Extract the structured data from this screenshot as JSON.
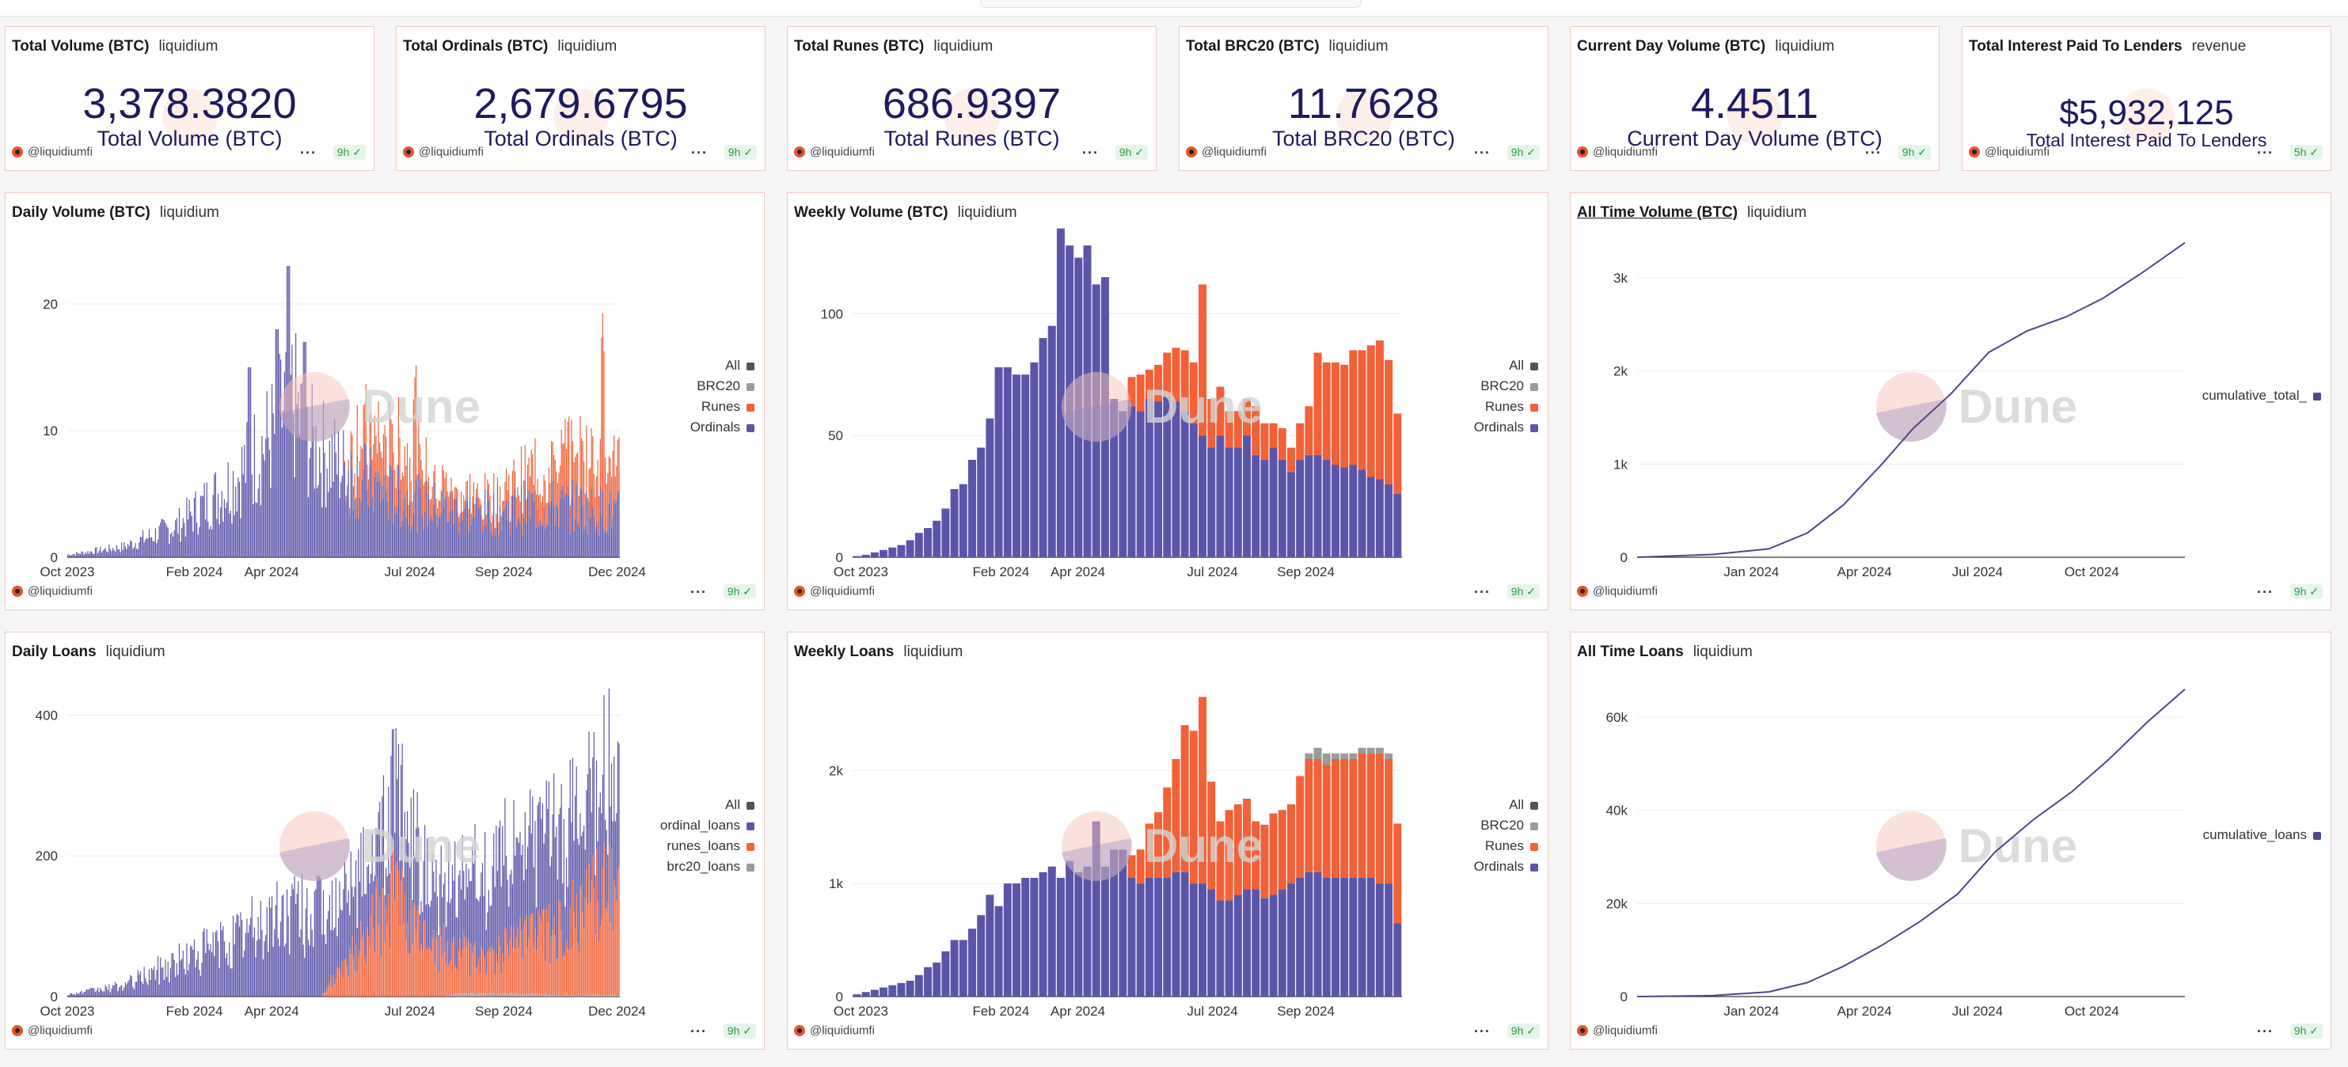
{
  "footer_handle": "@liquidiumfi",
  "more_label": "···",
  "watermark_text": "Dune",
  "colors": {
    "ordinals": "#5a55a8",
    "runes": "#f26137",
    "brc20": "#9b9b9b",
    "all": "#555555",
    "line": "#4b4a8a"
  },
  "counters": [
    {
      "title": "Total Volume (BTC)",
      "owner": "liquidium",
      "value": "3,378.3820",
      "label": "Total Volume (BTC)",
      "age": "9h"
    },
    {
      "title": "Total Ordinals (BTC)",
      "owner": "liquidium",
      "value": "2,679.6795",
      "label": "Total Ordinals (BTC)",
      "age": "9h"
    },
    {
      "title": "Total Runes (BTC)",
      "owner": "liquidium",
      "value": "686.9397",
      "label": "Total Runes (BTC)",
      "age": "9h"
    },
    {
      "title": "Total BRC20 (BTC)",
      "owner": "liquidium",
      "value": "11.7628",
      "label": "Total BRC20 (BTC)",
      "age": "9h"
    },
    {
      "title": "Current Day Volume (BTC)",
      "owner": "liquidium",
      "value": "4.4511",
      "label": "Current Day Volume (BTC)",
      "age": "9h"
    },
    {
      "title": "Total Interest Paid To Lenders",
      "owner": "revenue",
      "value": "$5,932,125",
      "label": "Total Interest Paid To Lenders",
      "age": "5h"
    }
  ],
  "charts": [
    {
      "title": "Daily Volume (BTC)",
      "owner": "liquidium",
      "age": "9h",
      "legend": [
        "All",
        "BRC20",
        "Runes",
        "Ordinals"
      ]
    },
    {
      "title": "Weekly Volume (BTC)",
      "owner": "liquidium",
      "age": "9h",
      "legend": [
        "All",
        "BRC20",
        "Runes",
        "Ordinals"
      ]
    },
    {
      "title": "All Time Volume (BTC)",
      "owner": "liquidium",
      "age": "9h",
      "legend": [
        "cumulative_total_"
      ]
    },
    {
      "title": "Daily Loans",
      "owner": "liquidium",
      "age": "9h",
      "legend": [
        "All",
        "ordinal_loans",
        "runes_loans",
        "brc20_loans"
      ]
    },
    {
      "title": "Weekly Loans",
      "owner": "liquidium",
      "age": "9h",
      "legend": [
        "All",
        "BRC20",
        "Runes",
        "Ordinals"
      ]
    },
    {
      "title": "All Time Loans",
      "owner": "liquidium",
      "age": "9h",
      "legend": [
        "cumulative_loans"
      ]
    }
  ],
  "chart_data": [
    {
      "type": "bar",
      "title": "Daily Volume (BTC)",
      "stacked": true,
      "x_start": "2023-10-01",
      "x_end": "2024-12-15",
      "xticks": [
        "Oct 2023",
        "Feb 2024",
        "Apr 2024",
        "Jul 2024",
        "Sep 2024",
        "Dec 2024"
      ],
      "ylim": [
        0,
        25
      ],
      "yticks": [
        0,
        10,
        20
      ],
      "legend_position": "right",
      "series": [
        {
          "name": "Ordinals",
          "profile": [
            [
              0,
              0.2
            ],
            [
              0.1,
              0.8
            ],
            [
              0.2,
              2.5
            ],
            [
              0.3,
              6
            ],
            [
              0.38,
              10
            ],
            [
              0.4,
              13
            ],
            [
              0.44,
              9
            ],
            [
              0.5,
              7
            ],
            [
              0.58,
              5
            ],
            [
              0.66,
              4
            ],
            [
              0.75,
              3.5
            ],
            [
              0.85,
              4
            ],
            [
              0.93,
              4
            ],
            [
              1,
              3.5
            ]
          ],
          "peaks": [
            [
              0.33,
              15
            ],
            [
              0.38,
              18
            ],
            [
              0.4,
              23
            ],
            [
              0.43,
              17
            ]
          ]
        },
        {
          "name": "Runes",
          "profile": [
            [
              0,
              0
            ],
            [
              0.5,
              0
            ],
            [
              0.53,
              3.5
            ],
            [
              0.6,
              4
            ],
            [
              0.65,
              3
            ],
            [
              0.7,
              1.5
            ],
            [
              0.75,
              1
            ],
            [
              0.82,
              2
            ],
            [
              0.9,
              4
            ],
            [
              0.97,
              4.5
            ],
            [
              1,
              3.5
            ]
          ],
          "peaks": [
            [
              0.63,
              9
            ],
            [
              0.97,
              14
            ]
          ]
        },
        {
          "name": "BRC20",
          "profile": [
            [
              0,
              0
            ],
            [
              1,
              0
            ]
          ]
        },
        {
          "name": "All",
          "profile": [
            [
              0,
              0
            ],
            [
              1,
              0
            ]
          ]
        }
      ]
    },
    {
      "type": "bar",
      "title": "Weekly Volume (BTC)",
      "stacked": true,
      "xticks": [
        "Oct 2023",
        "Feb 2024",
        "Apr 2024",
        "Jul 2024",
        "Sep 2024"
      ],
      "ylim": [
        0,
        130
      ],
      "yticks": [
        0,
        50,
        100
      ],
      "legend_position": "right",
      "categories_count": 62,
      "series": [
        {
          "name": "Ordinals",
          "values": [
            0.5,
            1,
            2,
            3,
            4,
            5,
            7,
            10,
            12,
            15,
            20,
            28,
            30,
            40,
            45,
            57,
            78,
            78,
            75,
            75,
            80,
            90,
            95,
            135,
            128,
            123,
            128,
            112,
            115,
            65,
            60,
            62,
            60,
            65,
            64,
            66,
            64,
            60,
            55,
            50,
            45,
            50,
            45,
            45,
            50,
            42,
            40,
            45,
            40,
            35,
            40,
            42,
            42,
            40,
            38,
            37,
            38,
            36,
            33,
            32,
            30,
            26
          ]
        },
        {
          "name": "Runes",
          "values": [
            0,
            0,
            0,
            0,
            0,
            0,
            0,
            0,
            0,
            0,
            0,
            0,
            0,
            0,
            0,
            0,
            0,
            0,
            0,
            0,
            0,
            0,
            0,
            0,
            0,
            0,
            0,
            0,
            0,
            0,
            0,
            12,
            15,
            12,
            15,
            18,
            22,
            25,
            25,
            62,
            20,
            20,
            15,
            15,
            15,
            20,
            15,
            10,
            13,
            10,
            15,
            20,
            42,
            40,
            42,
            42,
            47,
            49,
            54,
            57,
            51,
            33
          ]
        },
        {
          "name": "BRC20",
          "values": [
            0,
            0,
            0,
            0,
            0,
            0,
            0,
            0,
            0,
            0,
            0,
            0,
            0,
            0,
            0,
            0,
            0,
            0,
            0,
            0,
            0,
            0,
            0,
            0,
            0,
            0,
            0,
            0,
            0,
            0,
            0,
            0,
            0,
            0,
            0,
            0,
            0,
            0,
            0,
            0,
            0,
            0,
            0,
            0,
            0,
            0,
            0,
            0,
            0,
            0,
            0,
            0,
            0,
            0,
            0,
            0,
            0,
            0,
            0,
            0,
            0,
            0
          ]
        }
      ]
    },
    {
      "type": "line",
      "title": "All Time Volume (BTC)",
      "xticks": [
        "Jan 2024",
        "Apr 2024",
        "Jul 2024",
        "Oct 2024"
      ],
      "xlim": [
        "2023-10-01",
        "2024-12-15"
      ],
      "ylim": [
        0,
        3400
      ],
      "yticks": [
        0,
        1000,
        2000,
        3000
      ],
      "ytick_labels": [
        "0",
        "1k",
        "2k",
        "3k"
      ],
      "legend_position": "right",
      "series": [
        {
          "name": "cumulative_total_",
          "points": [
            [
              "2023-10-01",
              0
            ],
            [
              "2023-12-01",
              30
            ],
            [
              "2024-01-15",
              90
            ],
            [
              "2024-02-15",
              260
            ],
            [
              "2024-03-15",
              560
            ],
            [
              "2024-04-15",
              1000
            ],
            [
              "2024-05-10",
              1380
            ],
            [
              "2024-06-10",
              1760
            ],
            [
              "2024-07-10",
              2200
            ],
            [
              "2024-08-10",
              2430
            ],
            [
              "2024-09-10",
              2580
            ],
            [
              "2024-10-10",
              2780
            ],
            [
              "2024-11-10",
              3050
            ],
            [
              "2024-12-15",
              3378
            ]
          ]
        }
      ]
    },
    {
      "type": "bar",
      "title": "Daily Loans",
      "stacked": true,
      "x_start": "2023-10-01",
      "x_end": "2024-12-15",
      "xticks": [
        "Oct 2023",
        "Feb 2024",
        "Apr 2024",
        "Jul 2024",
        "Sep 2024",
        "Dec 2024"
      ],
      "ylim": [
        0,
        450
      ],
      "yticks": [
        0,
        200,
        400
      ],
      "legend_position": "right",
      "series": [
        {
          "name": "brc20_loans",
          "profile": [
            [
              0,
              0
            ],
            [
              0.68,
              0
            ],
            [
              0.7,
              4
            ],
            [
              0.85,
              4
            ],
            [
              0.9,
              2
            ],
            [
              1,
              2
            ]
          ]
        },
        {
          "name": "runes_loans",
          "profile": [
            [
              0,
              0
            ],
            [
              0.46,
              0
            ],
            [
              0.48,
              25
            ],
            [
              0.52,
              60
            ],
            [
              0.56,
              120
            ],
            [
              0.6,
              140
            ],
            [
              0.63,
              90
            ],
            [
              0.7,
              60
            ],
            [
              0.75,
              50
            ],
            [
              0.82,
              70
            ],
            [
              0.9,
              95
            ],
            [
              0.98,
              150
            ],
            [
              1,
              160
            ]
          ],
          "peaks": [
            [
              0.59,
              210
            ]
          ]
        },
        {
          "name": "ordinal_loans",
          "profile": [
            [
              0,
              3
            ],
            [
              0.1,
              15
            ],
            [
              0.2,
              50
            ],
            [
              0.3,
              80
            ],
            [
              0.4,
              120
            ],
            [
              0.45,
              120
            ],
            [
              0.5,
              90
            ],
            [
              0.56,
              110
            ],
            [
              0.6,
              130
            ],
            [
              0.65,
              110
            ],
            [
              0.75,
              120
            ],
            [
              0.85,
              130
            ],
            [
              0.95,
              150
            ],
            [
              1,
              140
            ]
          ],
          "peaks": [
            [
              0.59,
              170
            ]
          ]
        }
      ]
    },
    {
      "type": "bar",
      "title": "Weekly Loans",
      "stacked": true,
      "xticks": [
        "Oct 2023",
        "Feb 2024",
        "Apr 2024",
        "Jul 2024",
        "Sep 2024"
      ],
      "ylim": [
        0,
        2800
      ],
      "yticks": [
        0,
        1000,
        2000
      ],
      "ytick_labels": [
        "0",
        "1k",
        "2k"
      ],
      "legend_position": "right",
      "categories_count": 62,
      "series": [
        {
          "name": "Ordinals",
          "values": [
            20,
            40,
            60,
            80,
            100,
            120,
            140,
            190,
            260,
            300,
            400,
            500,
            500,
            600,
            720,
            900,
            800,
            1000,
            1000,
            1050,
            1050,
            1100,
            1150,
            1050,
            1200,
            1100,
            1150,
            1550,
            1150,
            1300,
            1300,
            1050,
            1000,
            1050,
            1050,
            1050,
            1100,
            1100,
            1000,
            1000,
            950,
            850,
            850,
            900,
            950,
            950,
            870,
            900,
            950,
            1000,
            1050,
            1100,
            1100,
            1050,
            1050,
            1050,
            1050,
            1050,
            1050,
            1000,
            1000,
            650
          ]
        },
        {
          "name": "Runes",
          "values": [
            0,
            0,
            0,
            0,
            0,
            0,
            0,
            0,
            0,
            0,
            0,
            0,
            0,
            0,
            0,
            0,
            0,
            0,
            0,
            0,
            0,
            0,
            0,
            0,
            0,
            0,
            0,
            0,
            0,
            0,
            0,
            200,
            300,
            480,
            580,
            800,
            1000,
            1300,
            1350,
            1650,
            950,
            700,
            800,
            800,
            800,
            600,
            650,
            720,
            700,
            700,
            900,
            1000,
            1000,
            1000,
            1050,
            1050,
            1050,
            1100,
            1100,
            1150,
            1100,
            880
          ]
        },
        {
          "name": "BRC20",
          "values": [
            0,
            0,
            0,
            0,
            0,
            0,
            0,
            0,
            0,
            0,
            0,
            0,
            0,
            0,
            0,
            0,
            0,
            0,
            0,
            0,
            0,
            0,
            0,
            0,
            0,
            0,
            0,
            0,
            0,
            0,
            0,
            0,
            0,
            0,
            0,
            0,
            0,
            0,
            0,
            0,
            0,
            0,
            0,
            0,
            0,
            0,
            0,
            0,
            0,
            0,
            0,
            50,
            100,
            100,
            50,
            50,
            50,
            50,
            50,
            50,
            50,
            0
          ]
        }
      ]
    },
    {
      "type": "line",
      "title": "All Time Loans",
      "xticks": [
        "Jan 2024",
        "Apr 2024",
        "Jul 2024",
        "Oct 2024"
      ],
      "xlim": [
        "2023-10-01",
        "2024-12-15"
      ],
      "ylim": [
        0,
        68000
      ],
      "yticks": [
        0,
        20000,
        40000,
        60000
      ],
      "ytick_labels": [
        "0",
        "20k",
        "40k",
        "60k"
      ],
      "legend_position": "right",
      "series": [
        {
          "name": "cumulative_loans",
          "points": [
            [
              "2023-10-01",
              0
            ],
            [
              "2023-12-01",
              200
            ],
            [
              "2024-01-15",
              1000
            ],
            [
              "2024-02-15",
              3000
            ],
            [
              "2024-03-15",
              6500
            ],
            [
              "2024-04-15",
              11000
            ],
            [
              "2024-05-15",
              16000
            ],
            [
              "2024-06-15",
              22000
            ],
            [
              "2024-07-15",
              31000
            ],
            [
              "2024-08-15",
              38000
            ],
            [
              "2024-09-15",
              44000
            ],
            [
              "2024-10-15",
              51000
            ],
            [
              "2024-11-15",
              59000
            ],
            [
              "2024-12-15",
              66000
            ]
          ]
        }
      ]
    }
  ]
}
